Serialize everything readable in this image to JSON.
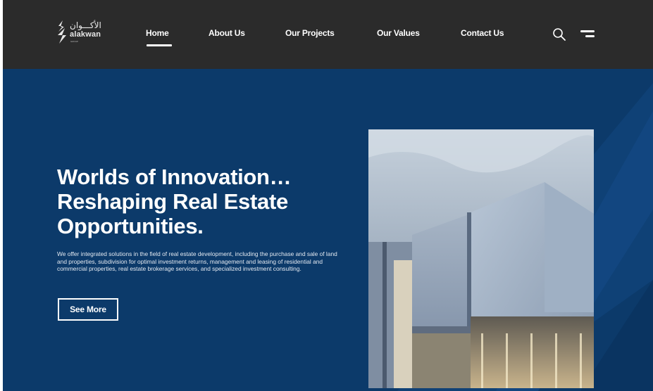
{
  "brand": {
    "arabic": "الأكـــوان",
    "latin": "alakwan",
    "tagline": "GROUP"
  },
  "nav": {
    "items": [
      {
        "label": "Home",
        "active": true
      },
      {
        "label": "About Us"
      },
      {
        "label": "Our Projects"
      },
      {
        "label": "Our Values"
      },
      {
        "label": "Contact Us"
      }
    ],
    "search_icon": "search-icon",
    "menu_icon": "menu-icon"
  },
  "hero": {
    "title_lines": [
      "Worlds of Innovation…",
      "Reshaping Real Estate",
      "Opportunities."
    ],
    "description": "We offer integrated solutions in the field of real estate development, including the purchase and sale of land and properties, subdivision for optimal investment returns, management and leasing of residential and commercial properties, real estate brokerage services, and specialized investment consulting.",
    "cta_label": "See More",
    "image_subject": "modern-building-dusk"
  },
  "colors": {
    "header_bg": "#2b2b2b",
    "hero_bg": "#0c3a6a",
    "text": "#ffffff"
  }
}
